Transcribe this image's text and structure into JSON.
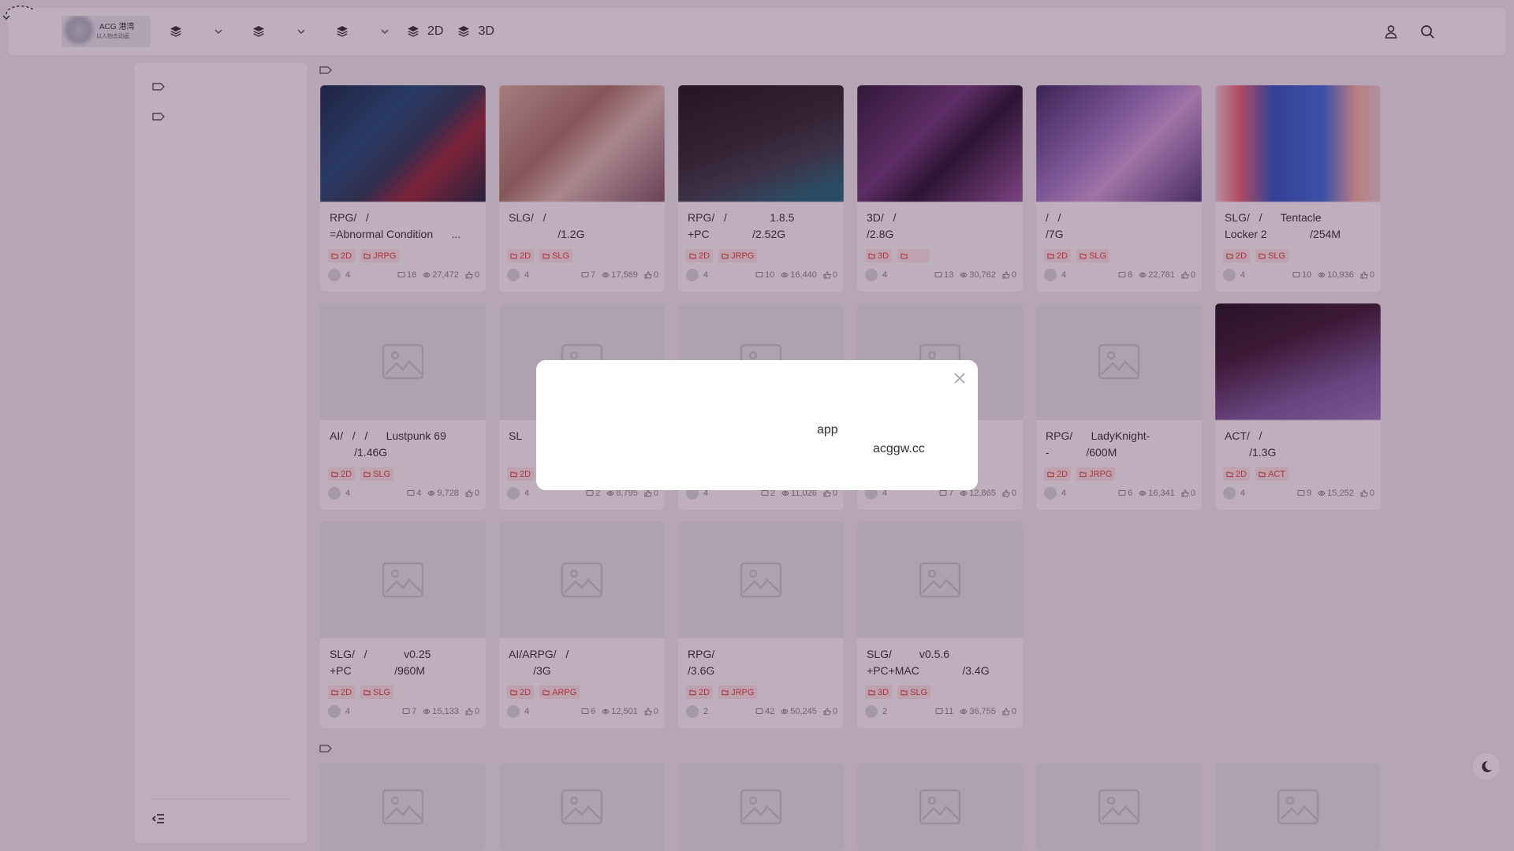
{
  "header": {
    "logo_text": "ACG 港湾",
    "logo_sub": "以人物去动画",
    "nav": [
      {
        "icon": "layers-icon",
        "label": "",
        "has_dropdown": true
      },
      {
        "icon": "layers-icon",
        "label": "",
        "has_dropdown": true
      },
      {
        "icon": "layers-icon",
        "label": "",
        "has_dropdown": true
      },
      {
        "icon": "layers-icon",
        "label": "2D",
        "has_dropdown": false
      },
      {
        "icon": "layers-icon",
        "label": "3D",
        "has_dropdown": false
      }
    ],
    "right_icons": [
      "user-icon",
      "search-icon"
    ]
  },
  "sidebar": {
    "items": [
      {
        "icon": "tag-icon"
      },
      {
        "icon": "tag-icon"
      }
    ],
    "collapse_icon": "collapse-sidebar-icon"
  },
  "theme": {
    "tag_bg": "#fdecec",
    "tag_color": "#e0453d",
    "overlay": "rgba(68,20,60,0.34)"
  },
  "cards": [
    {
      "title": "RPG/   /\n=Abnormal Condition      ...",
      "image": "dark-blue anime",
      "tags": [
        "2D",
        "JRPG"
      ],
      "author_count": "4",
      "comments": "16",
      "views": "27,472",
      "likes": "0"
    },
    {
      "title": "SLG/   /\n                /1.2G",
      "image": "pink room",
      "tags": [
        "2D",
        "SLG"
      ],
      "author_count": "4",
      "comments": "7",
      "views": "17,569",
      "likes": "0"
    },
    {
      "title": "RPG/   /              1.8.5\n+PC              /2.52G",
      "image": "dark street",
      "tags": [
        "2D",
        "JRPG"
      ],
      "author_count": "4",
      "comments": "10",
      "views": "16,440",
      "likes": "0"
    },
    {
      "title": "3D/   /\n/2.8G",
      "image": "purple action",
      "tags": [
        "3D",
        ""
      ],
      "author_count": "4",
      "comments": "13",
      "views": "30,762",
      "likes": "0"
    },
    {
      "title": "/   /\n/7G",
      "image": "purple pink",
      "tags": [
        "2D",
        "SLG"
      ],
      "author_count": "4",
      "comments": "8",
      "views": "22,781",
      "likes": "0"
    },
    {
      "title": "SLG/   /      Tentacle\nLocker 2              /254M",
      "image": "blue arcade",
      "tags": [
        "2D",
        "SLG"
      ],
      "author_count": "4",
      "comments": "10",
      "views": "10,936",
      "likes": "0"
    },
    {
      "title": "AI/   /   /      Lustpunk 69\n        /1.46G",
      "image": "",
      "tags": [
        "2D",
        "SLG"
      ],
      "author_count": "4",
      "comments": "4",
      "views": "9,728",
      "likes": "0"
    },
    {
      "title": "SL",
      "image": "",
      "tags": [
        "2D"
      ],
      "author_count": "4",
      "comments": "2",
      "views": "8,795",
      "likes": "0"
    },
    {
      "title": "",
      "image": "",
      "tags": [],
      "author_count": "4",
      "comments": "2",
      "views": "11,026",
      "likes": "0"
    },
    {
      "title": "",
      "image": "",
      "tags": [],
      "author_count": "4",
      "comments": "7",
      "views": "12,865",
      "likes": "0"
    },
    {
      "title": "RPG/      LadyKnight-\n-            /600M",
      "image": "",
      "tags": [
        "2D",
        "JRPG"
      ],
      "author_count": "4",
      "comments": "6",
      "views": "16,341",
      "likes": "0"
    },
    {
      "title": "ACT/   /\n        /1.3G",
      "image": "dark purple action",
      "tags": [
        "2D",
        "ACT"
      ],
      "author_count": "4",
      "comments": "9",
      "views": "15,252",
      "likes": "0"
    },
    {
      "title": "SLG/   /            v0.25\n+PC              /960M",
      "image": "",
      "tags": [
        "2D",
        "SLG"
      ],
      "author_count": "4",
      "comments": "7",
      "views": "15,133",
      "likes": "0"
    },
    {
      "title": "AI/ARPG/   /\n        /3G",
      "image": "",
      "tags": [
        "2D",
        "ARPG"
      ],
      "author_count": "4",
      "comments": "6",
      "views": "12,501",
      "likes": "0"
    },
    {
      "title": "RPG/\n/3.6G",
      "image": "",
      "tags": [
        "2D",
        "JRPG"
      ],
      "author_count": "2",
      "comments": "42",
      "views": "50,245",
      "likes": "0"
    },
    {
      "title": "SLG/         v0.5.6\n+PC+MAC              /3.4G",
      "image": "",
      "tags": [
        "3D",
        "SLG"
      ],
      "author_count": "2",
      "comments": "11",
      "views": "36,755",
      "likes": "0"
    }
  ],
  "modal": {
    "line1": "app",
    "line2": "acggw.cc"
  }
}
